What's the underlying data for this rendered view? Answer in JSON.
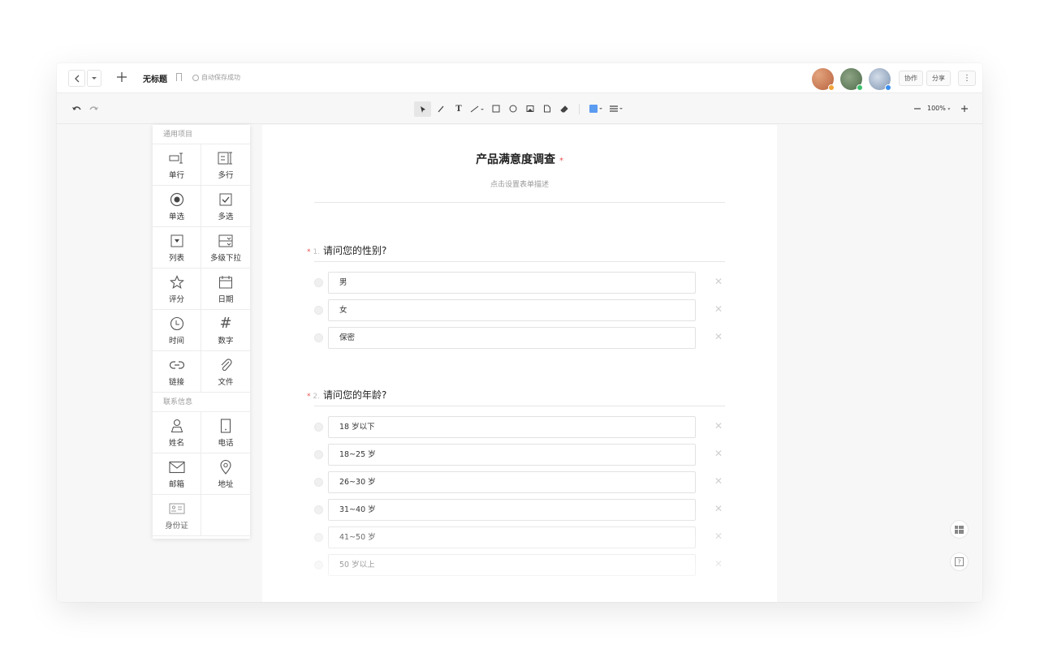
{
  "topbar": {
    "title": "无标题",
    "save_status": "自动保存成功",
    "collab_label": "协作",
    "share_label": "分享",
    "avatars": [
      {
        "color": "#c9825c",
        "dot": "#f0a43a"
      },
      {
        "color": "#6f8a6a",
        "dot": "#3bbf6b"
      },
      {
        "color": "#9fb0c8",
        "dot": "#3a8ef0"
      }
    ]
  },
  "toolbar": {
    "zoom_level": "100%",
    "fill_color": "#5b9bf0"
  },
  "palette": {
    "sections": [
      {
        "title": "通用项目",
        "items": [
          {
            "label": "单行",
            "icon": "single-line-icon"
          },
          {
            "label": "多行",
            "icon": "multi-line-icon"
          },
          {
            "label": "单选",
            "icon": "radio-icon"
          },
          {
            "label": "多选",
            "icon": "checkbox-icon"
          },
          {
            "label": "列表",
            "icon": "dropdown-icon"
          },
          {
            "label": "多级下拉",
            "icon": "cascade-icon"
          },
          {
            "label": "评分",
            "icon": "star-icon"
          },
          {
            "label": "日期",
            "icon": "calendar-icon"
          },
          {
            "label": "时间",
            "icon": "clock-icon"
          },
          {
            "label": "数字",
            "icon": "hash-icon"
          },
          {
            "label": "链接",
            "icon": "link-icon"
          },
          {
            "label": "文件",
            "icon": "paperclip-icon"
          }
        ]
      },
      {
        "title": "联系信息",
        "items": [
          {
            "label": "姓名",
            "icon": "person-icon"
          },
          {
            "label": "电话",
            "icon": "phone-icon"
          },
          {
            "label": "邮箱",
            "icon": "mail-icon"
          },
          {
            "label": "地址",
            "icon": "location-icon"
          },
          {
            "label": "身份证",
            "icon": "id-card-icon"
          }
        ]
      }
    ]
  },
  "form": {
    "title": "产品满意度调查",
    "required_mark": "*",
    "description": "点击设置表单描述",
    "questions": [
      {
        "number": "1.",
        "title": "请问您的性别?",
        "options": [
          "男",
          "女",
          "保密"
        ]
      },
      {
        "number": "2.",
        "title": "请问您的年龄?",
        "options": [
          "18 岁以下",
          "18~25 岁",
          "26~30 岁",
          "31~40 岁",
          "41~50 岁",
          "50 岁以上"
        ]
      }
    ]
  }
}
